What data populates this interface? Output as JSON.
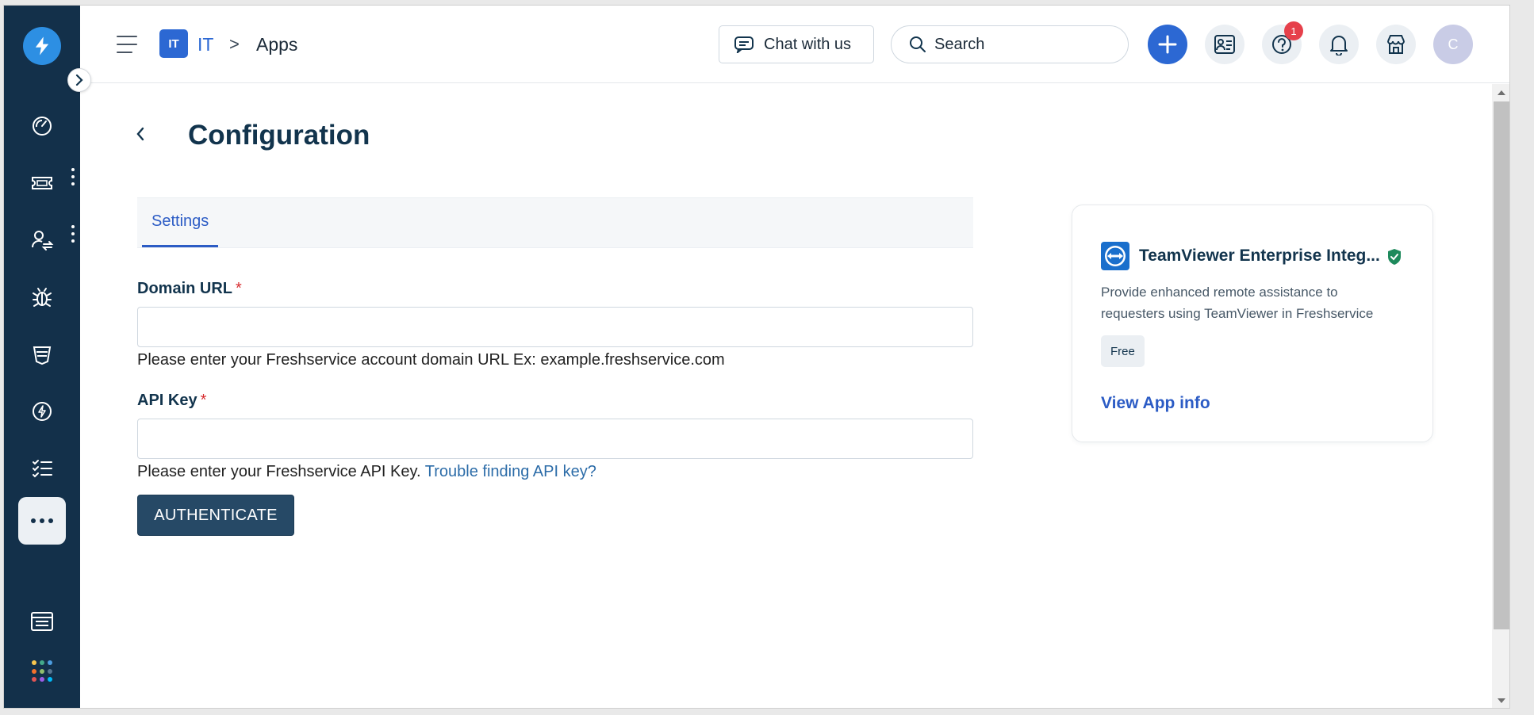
{
  "header": {
    "workspace_badge": "IT",
    "workspace_label": "IT",
    "breadcrumb_separator": ">",
    "breadcrumb_current": "Apps",
    "chat_label": "Chat with us",
    "search_placeholder": "Search",
    "notification_count": "1",
    "avatar_initial": "C"
  },
  "page": {
    "title": "Configuration",
    "tabs": [
      {
        "label": "Settings",
        "active": true
      }
    ]
  },
  "form": {
    "domain": {
      "label": "Domain URL",
      "required_mark": "*",
      "value": "",
      "help": "Please enter your Freshservice account domain URL Ex: example.freshservice.com"
    },
    "api_key": {
      "label": "API Key",
      "required_mark": "*",
      "value": "",
      "help": "Please enter your Freshservice API Key.",
      "help_link": "Trouble finding API key?"
    },
    "submit_label": "AUTHENTICATE"
  },
  "app_card": {
    "name": "TeamViewer Enterprise Integ...",
    "description": "Provide enhanced remote assistance to requesters using TeamViewer in Freshservice",
    "price": "Free",
    "view_info_label": "View App info"
  },
  "sidebar": {
    "items": [
      {
        "icon": "dashboard-icon"
      },
      {
        "icon": "tickets-icon"
      },
      {
        "icon": "changes-icon"
      },
      {
        "icon": "problems-icon"
      },
      {
        "icon": "assets-icon"
      },
      {
        "icon": "releases-icon"
      },
      {
        "icon": "tasks-icon"
      },
      {
        "icon": "more-icon"
      },
      {
        "icon": "service-catalog-icon"
      },
      {
        "icon": "apps-grid-icon"
      }
    ]
  },
  "colors": {
    "sidebar_bg": "#13304a",
    "accent_blue": "#2c68d3",
    "primary_button": "#264966",
    "required_red": "#d72d30",
    "badge_red": "#e6404b",
    "verified_green": "#1e8a5c"
  }
}
